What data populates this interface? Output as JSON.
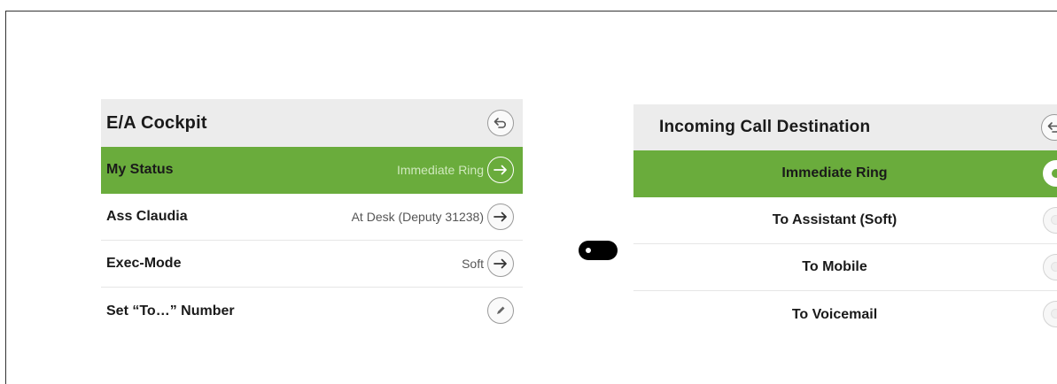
{
  "left_panel": {
    "title": "E/A Cockpit",
    "back_icon": "back-arrow-icon",
    "rows": [
      {
        "label": "My Status",
        "value": "Immediate Ring",
        "icon": "arrow-right-icon",
        "active": true
      },
      {
        "label": "Ass Claudia",
        "value": "At Desk (Deputy 31238)",
        "icon": "arrow-right-icon",
        "active": false
      },
      {
        "label": "Exec-Mode",
        "value": "Soft",
        "icon": "arrow-right-icon",
        "active": false
      },
      {
        "label": "Set “To…” Number",
        "value": "",
        "icon": "pencil-icon",
        "active": false
      }
    ]
  },
  "right_panel": {
    "title": "Incoming Call Destination",
    "back_icon": "back-arrow-icon",
    "options": [
      {
        "label": "Immediate Ring",
        "selected": true
      },
      {
        "label": "To Assistant (Soft)",
        "selected": false
      },
      {
        "label": "To Mobile",
        "selected": false
      },
      {
        "label": "To Voicemail",
        "selected": false
      }
    ]
  },
  "colors": {
    "accent_green": "#6aac3c",
    "header_gray": "#ececec"
  }
}
